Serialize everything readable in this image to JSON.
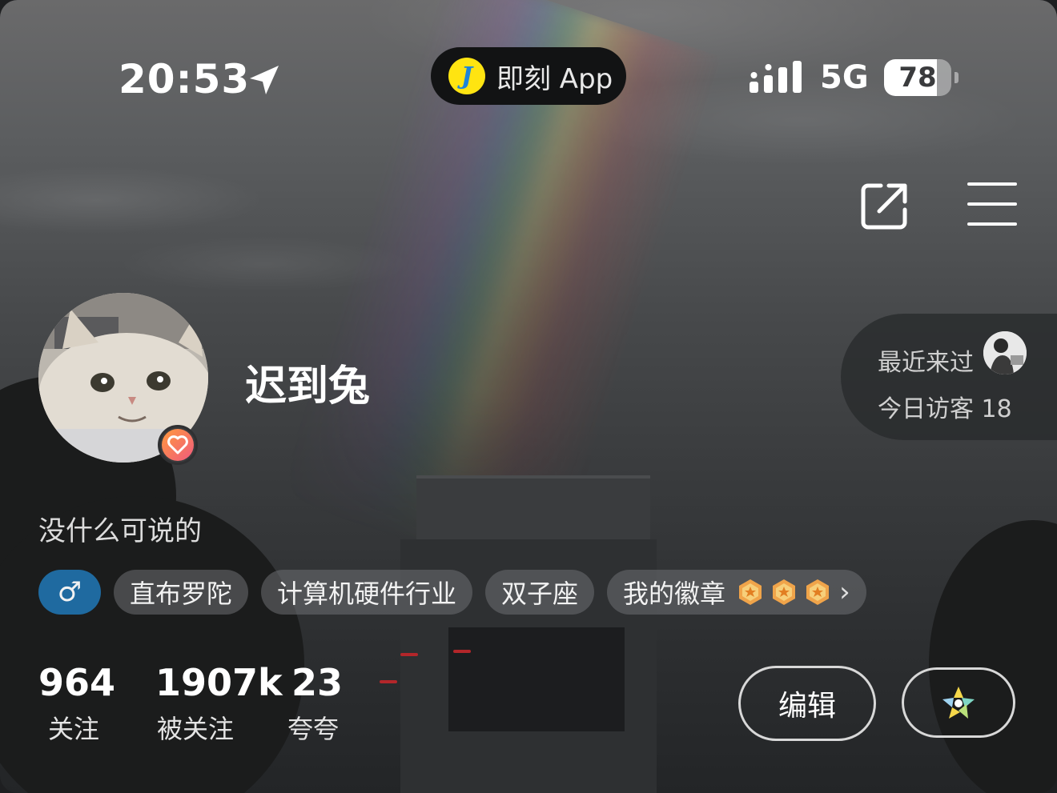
{
  "status_bar": {
    "time": "20:53",
    "island_app_name": "即刻 App",
    "island_logo_letter": "J",
    "network": "5G",
    "battery_level": "78",
    "battery_fraction": 0.78
  },
  "header": {
    "share_icon": "share-icon",
    "menu_icon": "menu-icon"
  },
  "profile": {
    "username": "迟到兔",
    "bio": "没什么可说的",
    "avatar_badge_icon": "heart-icon"
  },
  "visitors": {
    "recent_label": "最近来过",
    "today_label": "今日访客 18"
  },
  "tags": {
    "gender_symbol": "♂",
    "items": [
      "直布罗陀",
      "计算机硬件行业",
      "双子座"
    ],
    "badges_label": "我的徽章",
    "chevron": "›"
  },
  "stats": [
    {
      "value": "964",
      "label": "关注"
    },
    {
      "value": "1907k",
      "label": "被关注"
    },
    {
      "value": "23",
      "label": "夸夸"
    }
  ],
  "actions": {
    "edit_label": "编辑"
  },
  "colors": {
    "gender_tag": "#1f6aa0",
    "logo_yellow": "#ffe411",
    "logo_blue": "#1d84d9"
  }
}
